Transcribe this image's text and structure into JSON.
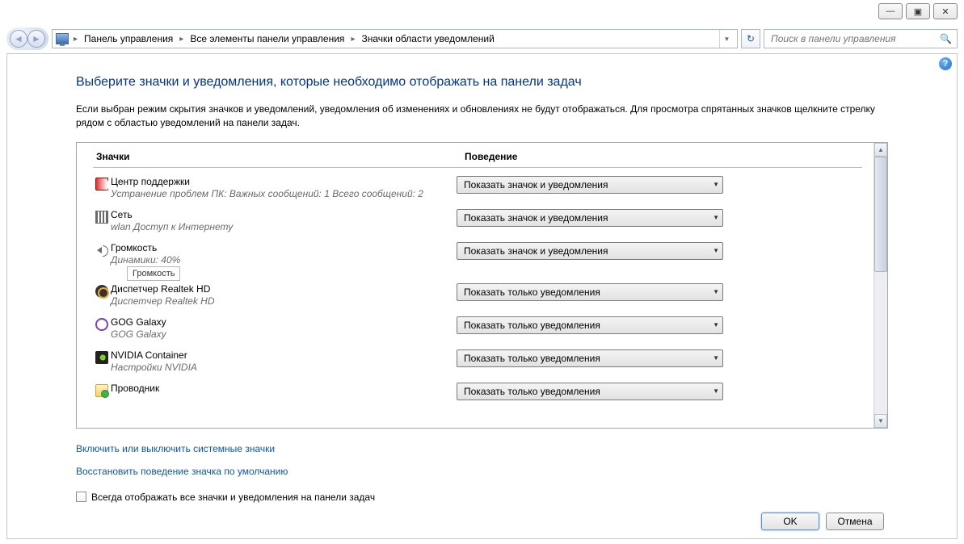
{
  "window_controls": {
    "minimize": "—",
    "maximize": "▣",
    "close": "✕"
  },
  "nav": {
    "back": "◄",
    "forward": "►"
  },
  "breadcrumbs": [
    "Панель управления",
    "Все элементы панели управления",
    "Значки области уведомлений"
  ],
  "address_dropdown": "▼",
  "refresh": "↻",
  "search": {
    "placeholder": "Поиск в панели управления"
  },
  "help": "?",
  "page_title": "Выберите значки и уведомления, которые необходимо отображать на панели задач",
  "description": "Если выбран режим скрытия значков и уведомлений, уведомления об изменениях и обновлениях не будут отображаться. Для просмотра спрятанных значков щелкните стрелку рядом с областью уведомлений на панели задач.",
  "columns": {
    "icons": "Значки",
    "behavior": "Поведение"
  },
  "behavior_options": {
    "show_all": "Показать значок и уведомления",
    "notify_only": "Показать только уведомления"
  },
  "items": [
    {
      "icon": "flag-icon",
      "title": "Центр поддержки",
      "sub": "Устранение проблем ПК: Важных сообщений: 1  Всего сообщений: 2",
      "behavior": "Показать значок и уведомления"
    },
    {
      "icon": "network-icon",
      "title": "Сеть",
      "sub": "wlan Доступ к Интернету",
      "behavior": "Показать значок и уведомления"
    },
    {
      "icon": "volume-icon",
      "title": "Громкость",
      "sub": "Динамики: 40%",
      "behavior": "Показать значок и уведомления",
      "tooltip": "Громкость"
    },
    {
      "icon": "realtek-icon",
      "title": "Диспетчер Realtek HD",
      "sub": "Диспетчер Realtek HD",
      "behavior": "Показать только уведомления"
    },
    {
      "icon": "gog-icon",
      "title": "GOG Galaxy",
      "sub": "GOG Galaxy",
      "behavior": "Показать только уведомления"
    },
    {
      "icon": "nvidia-icon",
      "title": "NVIDIA Container",
      "sub": "Настройки NVIDIA",
      "behavior": "Показать только уведомления"
    },
    {
      "icon": "explorer-icon",
      "title": "Проводник",
      "sub": "",
      "behavior": "Показать только уведомления"
    }
  ],
  "links": {
    "system_icons": "Включить или выключить системные значки",
    "restore_defaults": "Восстановить поведение значка по умолчанию"
  },
  "always_show_label": "Всегда отображать все значки и уведомления на панели задач",
  "buttons": {
    "ok": "OK",
    "cancel": "Отмена"
  },
  "scroll": {
    "up": "▲",
    "down": "▼"
  }
}
